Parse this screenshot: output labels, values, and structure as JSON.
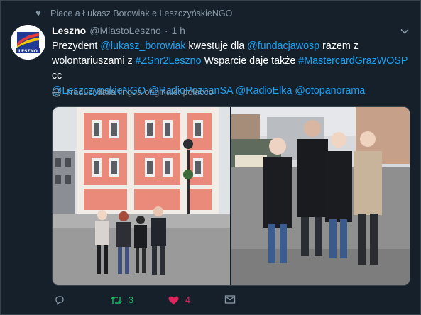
{
  "social_context": "Piace a Łukasz Borowiak e LeszczyńskieNGO",
  "author": {
    "name": "Leszno",
    "handle": "@MiastoLeszno",
    "separator": "·",
    "time": "1 h",
    "avatar_text": "LESZNO"
  },
  "tweet": {
    "t1": "Prezydent ",
    "m1": "@lukasz_borowiak",
    "t2": " kwestuje dla ",
    "m2": "@fundacjawosp",
    "t3": " razem z wolontariuszami z ",
    "h1": "#ZSnr2Leszno",
    "t4": " Wsparcie daje także ",
    "h2": "#MastercardGrazWOSP",
    "t5": " cc ",
    "m3": "@LeszczynskieNGO",
    "m4": "@RadioPoznanSA",
    "m5": "@RadioElka",
    "m6": "@otopanorama"
  },
  "translate_label": "Traduci dalla lingua originale: polacco",
  "actions": {
    "reply_count": "",
    "retweet_count": "3",
    "like_count": "4"
  },
  "colors": {
    "background": "#15202b",
    "link": "#1da1f2",
    "secondary_text": "#8899a6",
    "retweet_active": "#17bf63",
    "like_active": "#e0245e"
  },
  "icons": [
    "heart-icon",
    "chevron-down-icon",
    "globe-icon",
    "reply-icon",
    "retweet-icon",
    "like-icon",
    "message-icon"
  ]
}
